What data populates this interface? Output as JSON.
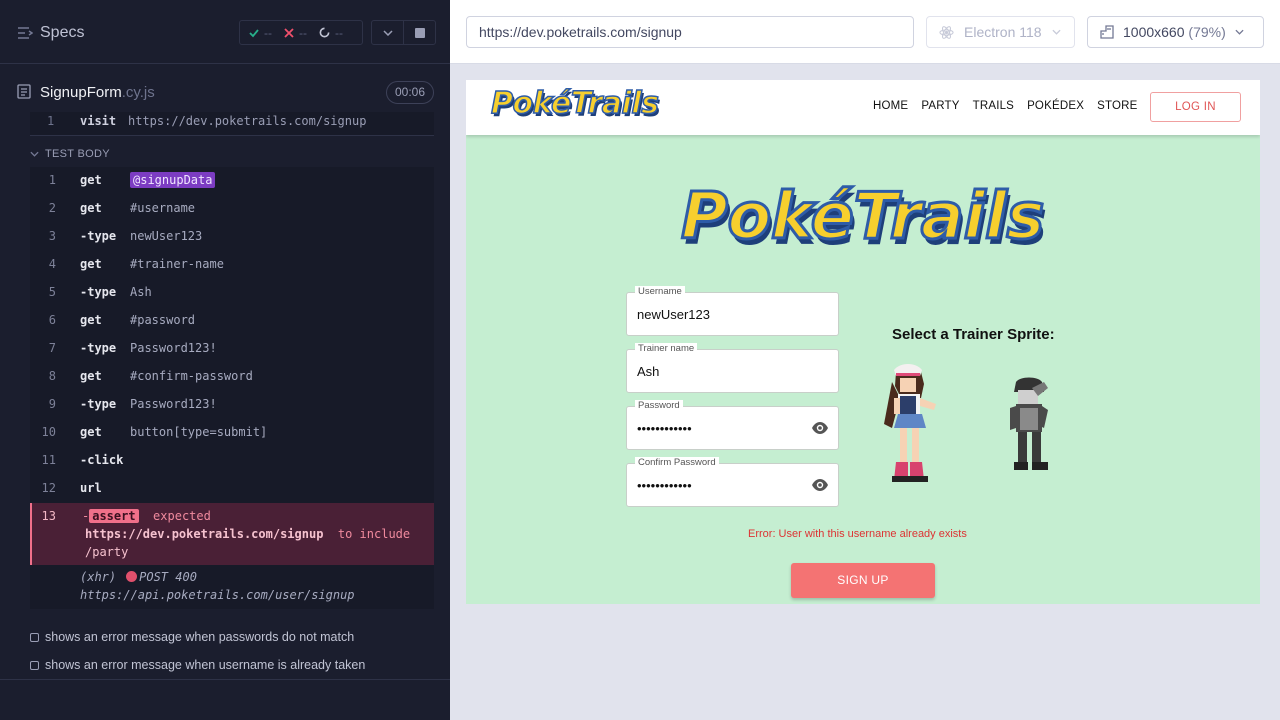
{
  "reporter": {
    "specs_title": "Specs",
    "stats": {
      "passed": "--",
      "failed": "--",
      "pending": "--"
    },
    "spec_file": {
      "name": "SignupForm",
      "ext": ".cy.js",
      "duration": "00:06"
    },
    "hook_partial": {
      "line": "1",
      "command": "visit",
      "arg": "https://dev.poketrails.com/signup"
    },
    "test_body_label": "TEST BODY",
    "commands": [
      {
        "line": "1",
        "command": "get",
        "arg": "@signupData",
        "alias": true
      },
      {
        "line": "2",
        "command": "get",
        "arg": "#username"
      },
      {
        "line": "3",
        "command": "-type",
        "arg": "newUser123"
      },
      {
        "line": "4",
        "command": "get",
        "arg": "#trainer-name"
      },
      {
        "line": "5",
        "command": "-type",
        "arg": "Ash"
      },
      {
        "line": "6",
        "command": "get",
        "arg": "#password"
      },
      {
        "line": "7",
        "command": "-type",
        "arg": "Password123!"
      },
      {
        "line": "8",
        "command": "get",
        "arg": "#confirm-password"
      },
      {
        "line": "9",
        "command": "-type",
        "arg": "Password123!"
      },
      {
        "line": "10",
        "command": "get",
        "arg": "button[type=submit]"
      },
      {
        "line": "11",
        "command": "-click",
        "arg": ""
      },
      {
        "line": "12",
        "command": "url",
        "arg": ""
      }
    ],
    "assert": {
      "line": "13",
      "dash": "-",
      "label": "assert",
      "expected": "expected",
      "url": "https://dev.poketrails.com/signup",
      "to_include": "to include",
      "value": "/party"
    },
    "xhr": {
      "prefix": "(xhr)",
      "status": "POST 400",
      "url": "https://api.poketrails.com/user/signup"
    },
    "other_tests": [
      "shows an error message when passwords do not match",
      "shows an error message when username is already taken"
    ]
  },
  "browser_bar": {
    "url": "https://dev.poketrails.com/signup",
    "browser": "Electron 118",
    "viewport": "1000x660",
    "scale": "(79%)"
  },
  "app": {
    "logo_text": "PokéTrails",
    "nav": [
      "HOME",
      "PARTY",
      "TRAILS",
      "POKÉDEX",
      "STORE"
    ],
    "login_label": "LOG IN",
    "hero_logo_text": "PokéTrails",
    "fields": {
      "username": {
        "label": "Username",
        "value": "newUser123"
      },
      "trainer_name": {
        "label": "Trainer name",
        "value": "Ash"
      },
      "password": {
        "label": "Password",
        "value": "••••••••••••"
      },
      "confirm_password": {
        "label": "Confirm Password",
        "value": "••••••••••••"
      }
    },
    "sprite_title": "Select a Trainer Sprite:",
    "error": "Error: User with this username already exists",
    "signup_label": "SIGN UP"
  },
  "colors": {
    "reporter_bg": "#1b1e2e",
    "aut_bg": "#c5eed1",
    "error_red": "#dd3333",
    "signup_btn": "#f47373",
    "assert_bg": "#4a2036"
  }
}
